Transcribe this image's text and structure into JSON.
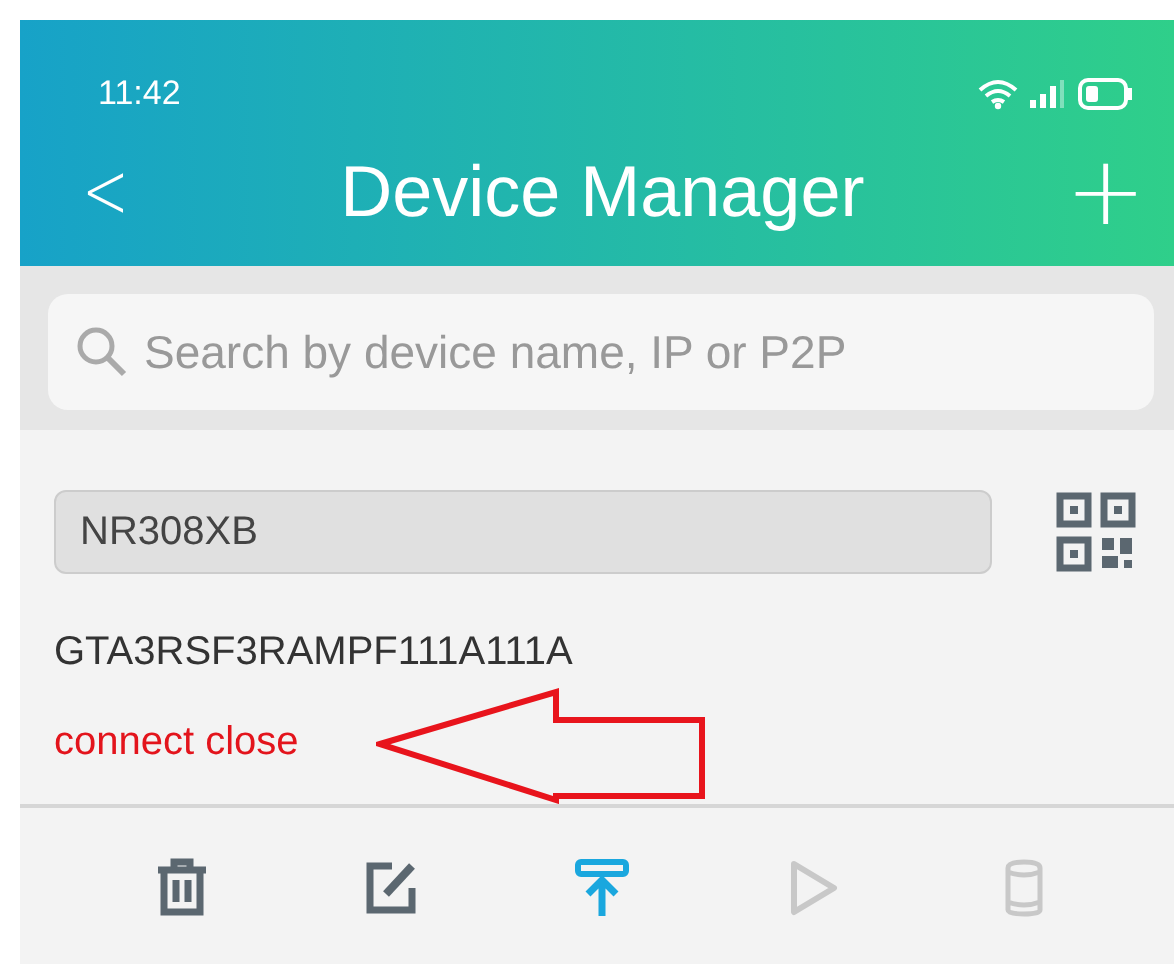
{
  "status_bar": {
    "time": "11:42"
  },
  "header": {
    "back": "<",
    "title": "Device Manager",
    "add": "+"
  },
  "search": {
    "placeholder": "Search by device name, IP or P2P"
  },
  "device": {
    "name": "NR308XB",
    "serial": "GTA3RSF3RAMPF111A111A",
    "status": "connect close"
  },
  "annotation": {
    "kind": "arrow"
  },
  "toolbar": [
    {
      "kind": "delete",
      "disabled": false,
      "selected": false
    },
    {
      "kind": "edit",
      "disabled": false,
      "selected": false
    },
    {
      "kind": "pin-top",
      "disabled": false,
      "selected": true
    },
    {
      "kind": "play",
      "disabled": true,
      "selected": false
    },
    {
      "kind": "storage",
      "disabled": true,
      "selected": false
    }
  ]
}
